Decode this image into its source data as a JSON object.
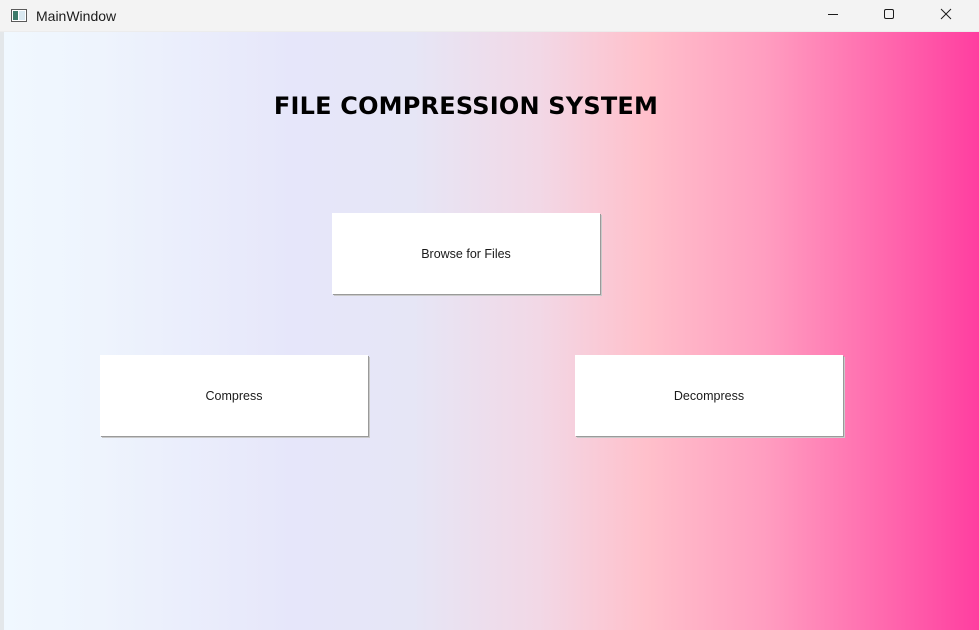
{
  "window": {
    "title": "MainWindow",
    "icon": "window-app-icon",
    "controls": {
      "minimize_icon": "minimize-icon",
      "maximize_icon": "maximize-icon",
      "close_icon": "close-icon"
    }
  },
  "main": {
    "heading": "FILE COMPRESSION SYSTEM",
    "buttons": {
      "browse": "Browse for Files",
      "compress": "Compress",
      "decompress": "Decompress"
    }
  },
  "colors": {
    "gradient_start": "#f0f8ff",
    "gradient_mid_lavender": "#e6e6fa",
    "gradient_mid_pink": "#ffc0cb",
    "gradient_end": "#ff3ea0",
    "button_bg": "#ffffff"
  }
}
